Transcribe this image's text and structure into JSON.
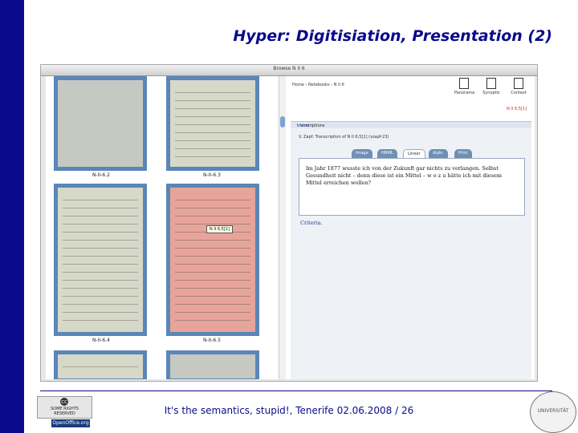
{
  "sidebar": {
    "vertical_title": "It's the semantics, stupid!"
  },
  "slide": {
    "title": "Hyper: Digitisiation, Presentation (2)"
  },
  "screenshot": {
    "window_title": "Browse N II 6",
    "thumbnails": [
      {
        "caption": "N-II-6.2"
      },
      {
        "caption": "N-II-6.3"
      },
      {
        "caption": "N-II-6.4"
      },
      {
        "caption": "N-II-6.5"
      }
    ],
    "thumb_tooltip": "N II 6,5[1]",
    "breadcrumb": "Home › Notebooks › N II 6",
    "toolbar": [
      {
        "label": "Panorama",
        "icon": "panorama-icon"
      },
      {
        "label": "Synoptic",
        "icon": "synoptic-icon"
      },
      {
        "label": "Context",
        "icon": "context-icon"
      }
    ],
    "page_id": "N II 6,5[1]",
    "transcriptions_label": "transcriptions",
    "transcriptions_link": "html",
    "author_line": "V. Zapf: Transcription of N II 6,5[1] (vzapf-23)",
    "tabs": [
      {
        "label": "Image",
        "active": false
      },
      {
        "label": "HNML",
        "active": false
      },
      {
        "label": "Linear",
        "active": true
      },
      {
        "label": "diplo.",
        "active": false
      },
      {
        "label": "Print",
        "active": false
      }
    ],
    "transcription_text": "Im Jahr 1877 wusste ich von der Zukunft gar nichts zu verlangen. Selbst Gesundheit nicht – denn diese ist ein Mittel – w o z u hätte ich mit diesem Mittel erreichen wollen?",
    "criteria_link": "Criteria."
  },
  "footer": {
    "text": "It's the semantics, stupid!, Tenerife 02.06.2008 / 26",
    "cc_label": "SOME RIGHTS RESERVED",
    "oo_label": "OpenOffice.org",
    "seal_label": "UNIVERSITÄT"
  },
  "colors": {
    "brand": "#0a0a8c",
    "thumb_frame": "#5a86b8",
    "tab": "#6f8fb4"
  }
}
